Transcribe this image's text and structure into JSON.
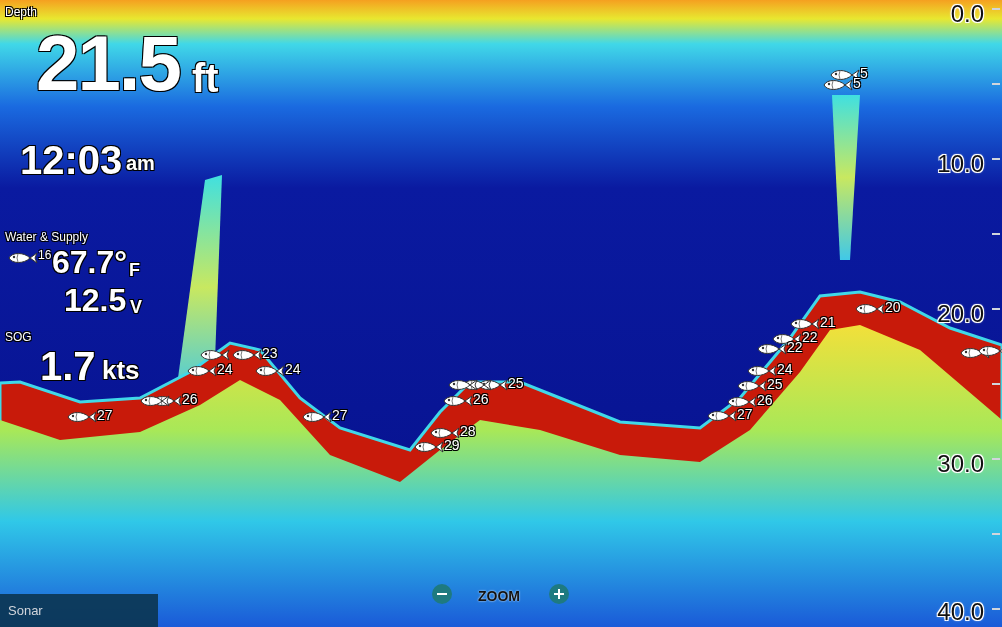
{
  "readouts": {
    "depth": {
      "label": "Depth",
      "value": "21.5",
      "unit": "ft"
    },
    "time": {
      "value": "12:03",
      "unit": "am"
    },
    "water": {
      "label": "Water & Supply",
      "temperature": "67.7°",
      "temperature_unit": "F",
      "voltage": "12.5",
      "voltage_unit": "V"
    },
    "sog": {
      "label": "SOG",
      "value": "1.7",
      "unit": "kts"
    }
  },
  "depth_scale": [
    "0.0",
    "10.0",
    "20.0",
    "30.0",
    "40.0"
  ],
  "fish": [
    {
      "depth": "5"
    },
    {
      "depth": "5"
    },
    {
      "depth": "16"
    },
    {
      "depth": "23"
    },
    {
      "depth": "24"
    },
    {
      "depth": "24"
    },
    {
      "depth": "26"
    },
    {
      "depth": "27"
    },
    {
      "depth": "27"
    },
    {
      "depth": "25"
    },
    {
      "depth": "26"
    },
    {
      "depth": "28"
    },
    {
      "depth": "29"
    },
    {
      "depth": "20"
    },
    {
      "depth": "21"
    },
    {
      "depth": "22"
    },
    {
      "depth": "22"
    },
    {
      "depth": "24"
    },
    {
      "depth": "25"
    },
    {
      "depth": "26"
    },
    {
      "depth": "27"
    }
  ],
  "panel_label": "Sonar",
  "zoom": {
    "label": "ZOOM"
  }
}
